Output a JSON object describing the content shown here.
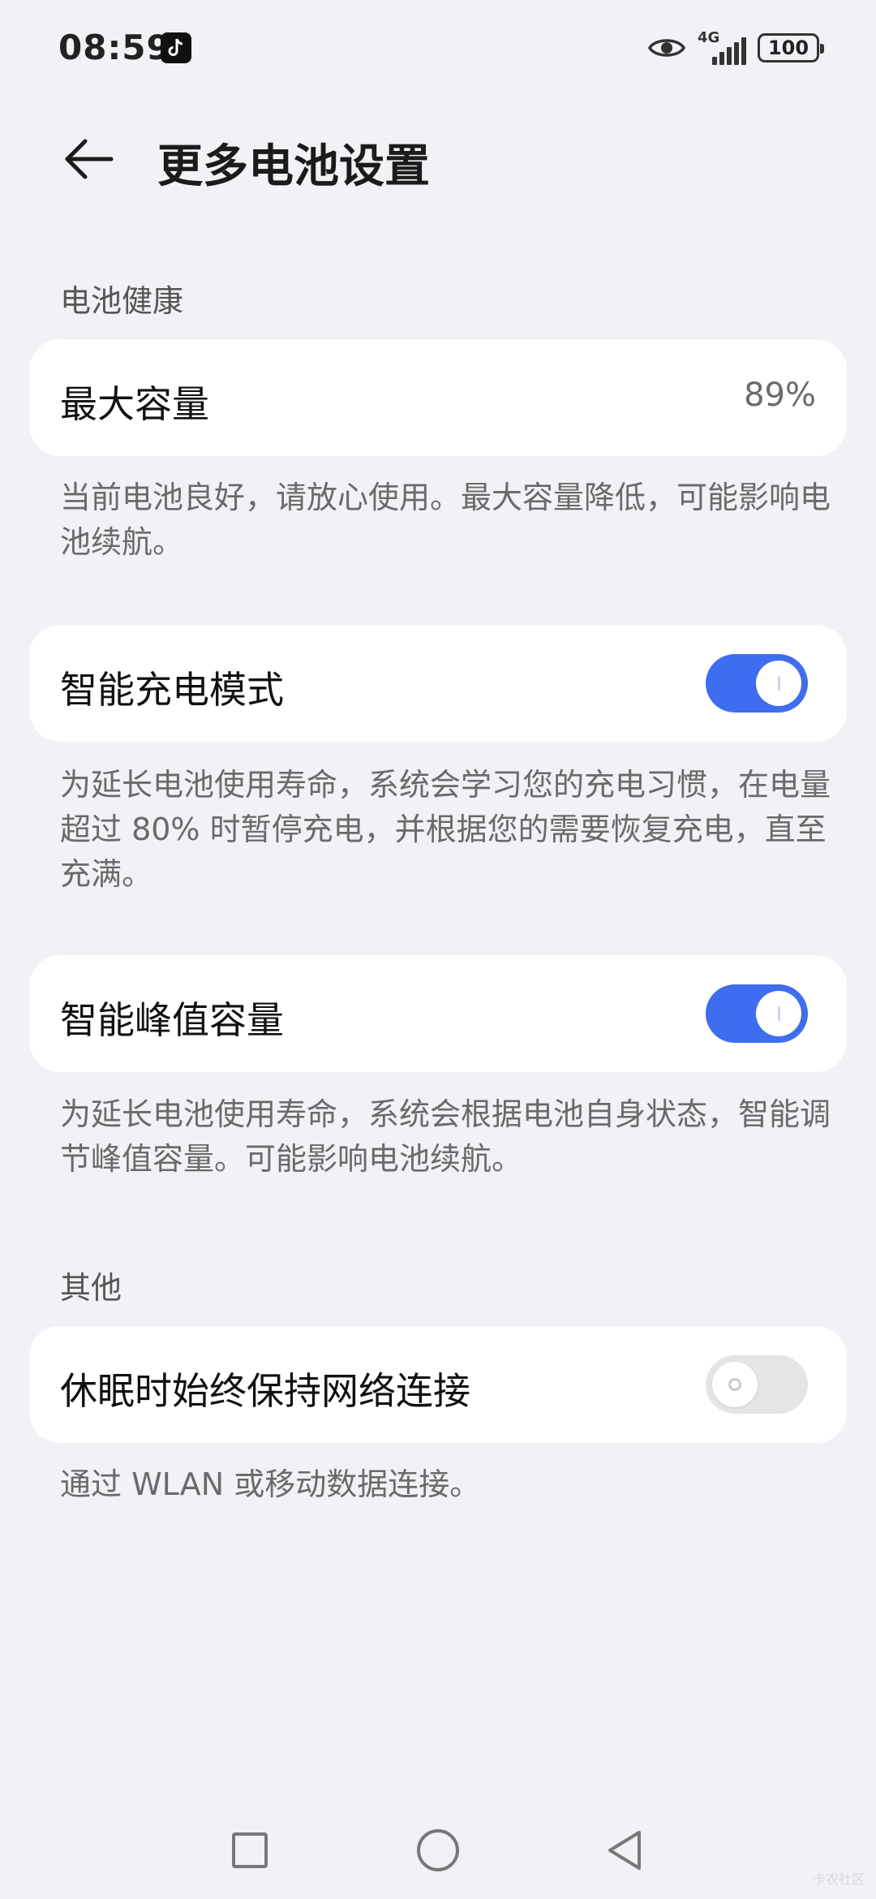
{
  "status_bar": {
    "time": "08:59",
    "network": "4G",
    "battery": "100",
    "icons": [
      "tiktok-icon",
      "eye-icon",
      "signal-icon",
      "battery-icon"
    ]
  },
  "header": {
    "title": "更多电池设置",
    "back_icon": "arrow-left-icon"
  },
  "sections": {
    "battery_health": "电池健康",
    "other": "其他"
  },
  "max_capacity": {
    "label": "最大容量",
    "value": "89%",
    "description": "当前电池良好，请放心使用。最大容量降低，可能影响电池续航。"
  },
  "smart_charging": {
    "label": "智能充电模式",
    "enabled": true,
    "description": "为延长电池使用寿命，系统会学习您的充电习惯，在电量超过 80% 时暂停充电，并根据您的需要恢复充电，直至充满。"
  },
  "smart_peak": {
    "label": "智能峰值容量",
    "enabled": true,
    "description": "为延长电池使用寿命，系统会根据电池自身状态，智能调节峰值容量。可能影响电池续航。"
  },
  "keep_network": {
    "label": "休眠时始终保持网络连接",
    "enabled": false,
    "description": "通过 WLAN 或移动数据连接。"
  },
  "nav_bar": {
    "icons": [
      "recent-apps-icon",
      "home-icon",
      "back-icon"
    ]
  },
  "watermark": "卡农社区",
  "colors": {
    "background": "#f1f1f6",
    "card": "#ffffff",
    "accent": "#3e6df0",
    "toggle_off": "#e5e5e8"
  }
}
